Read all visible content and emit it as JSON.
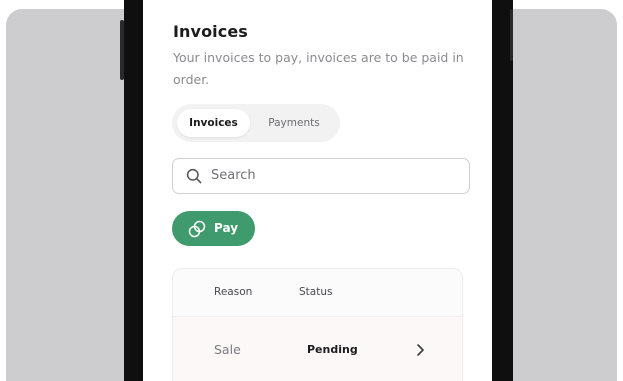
{
  "page": {
    "title": "Invoices",
    "subtitle": "Your invoices to pay, invoices are to be paid in order."
  },
  "tabs": {
    "active": "Invoices",
    "inactive": "Payments"
  },
  "search": {
    "placeholder": "Search",
    "icon": "search-icon"
  },
  "pay_button": {
    "label": "Pay",
    "icon": "pay-icon",
    "color": "#3f9a6d"
  },
  "table": {
    "columns": [
      "Reason",
      "Status"
    ],
    "rows": [
      {
        "reason": "Sale",
        "status": "Pending",
        "icon": "chevron-right-icon"
      }
    ]
  },
  "colors": {
    "backdrop": "#cdcdcf",
    "phone_frame": "#0f0f10",
    "accent_green": "#3f9a6d"
  }
}
